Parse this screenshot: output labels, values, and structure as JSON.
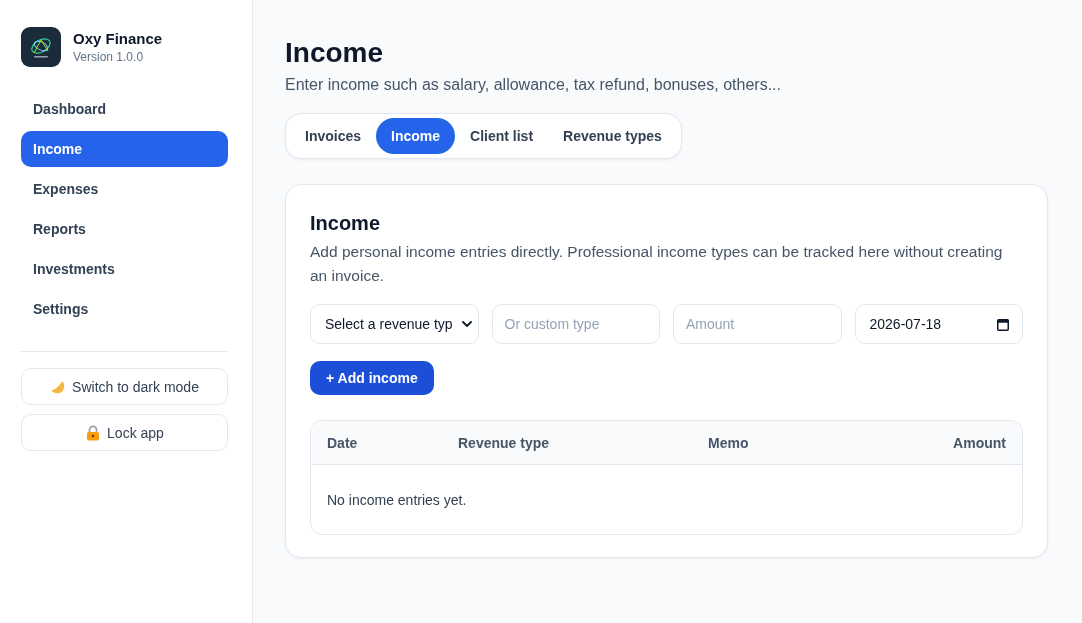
{
  "sidebar": {
    "app_name": "Oxy Finance",
    "version": "Version 1.0.0",
    "nav": [
      {
        "label": "Dashboard",
        "selected": false
      },
      {
        "label": "Income",
        "selected": true
      },
      {
        "label": "Expenses",
        "selected": false
      },
      {
        "label": "Reports",
        "selected": false
      },
      {
        "label": "Investments",
        "selected": false
      },
      {
        "label": "Settings",
        "selected": false
      }
    ],
    "actions": [
      {
        "kind": "theme",
        "label": "Switch to dark mode"
      },
      {
        "kind": "lock",
        "label": "Lock app"
      }
    ]
  },
  "page": {
    "title": "Income",
    "subtitle": "Enter income such as salary, allowance, tax refund, bonuses, others..."
  },
  "tabs": [
    {
      "label": "Invoices",
      "selected": false
    },
    {
      "label": "Income",
      "selected": true
    },
    {
      "label": "Client list",
      "selected": false
    },
    {
      "label": "Revenue types",
      "selected": false
    }
  ],
  "card": {
    "title": "Income",
    "description": "Add personal income entries directly. Professional income types can be tracked here without creating an invoice.",
    "fields": [
      {
        "kind": "select",
        "value": "Select a revenue typ"
      },
      {
        "kind": "text",
        "placeholder": "Or custom type"
      },
      {
        "kind": "text",
        "placeholder": "Amount"
      },
      {
        "kind": "date",
        "value": "2026-07-18"
      }
    ],
    "add_button": "+ Add income",
    "table": {
      "columns": [
        "Date",
        "Revenue type",
        "Memo",
        "Amount"
      ],
      "empty_message": "No income entries yet."
    }
  }
}
